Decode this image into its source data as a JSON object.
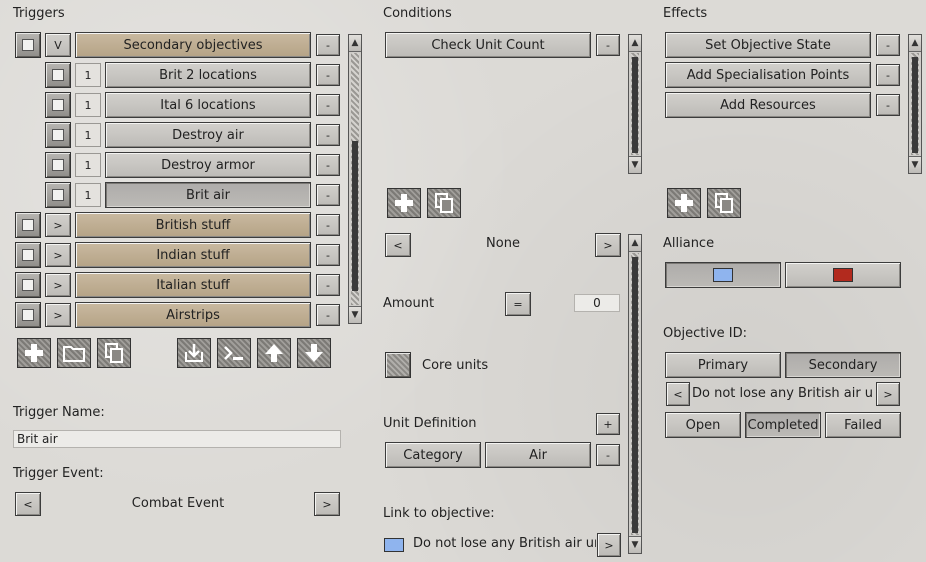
{
  "triggers": {
    "heading": "Triggers",
    "rows": [
      {
        "level": 0,
        "toggle": "V",
        "label": "Secondary objectives",
        "style": "tan"
      },
      {
        "level": 1,
        "count": "1",
        "label": "Brit 2 locations",
        "style": "grey"
      },
      {
        "level": 1,
        "count": "1",
        "label": "Ital 6 locations",
        "style": "grey"
      },
      {
        "level": 1,
        "count": "1",
        "label": "Destroy air",
        "style": "grey"
      },
      {
        "level": 1,
        "count": "1",
        "label": "Destroy armor",
        "style": "grey"
      },
      {
        "level": 1,
        "count": "1",
        "label": "Brit air",
        "style": "selected"
      },
      {
        "level": 0,
        "toggle": ">",
        "label": "British stuff",
        "style": "tan"
      },
      {
        "level": 0,
        "toggle": ">",
        "label": "Indian stuff",
        "style": "tan"
      },
      {
        "level": 0,
        "toggle": ">",
        "label": "Italian stuff",
        "style": "tan"
      },
      {
        "level": 0,
        "toggle": ">",
        "label": "Airstrips",
        "style": "tan"
      }
    ],
    "remove_label": "-",
    "toolbar_icons": [
      "add-icon",
      "folder-icon",
      "copy-icon",
      "import-icon",
      "console-icon",
      "move-up-icon",
      "move-down-icon"
    ],
    "name_label": "Trigger Name:",
    "name_value": "Brit air",
    "event_label": "Trigger Event:",
    "event_value": "Combat Event",
    "prev": "<",
    "next": ">"
  },
  "conditions": {
    "heading": "Conditions",
    "items": [
      "Check Unit Count"
    ],
    "remove_label": "-",
    "selector_value": "None",
    "prev": "<",
    "next": ">",
    "amount_label": "Amount",
    "amount_op": "=",
    "amount_value": "0",
    "core_units_label": "Core units",
    "unit_def_label": "Unit Definition",
    "unit_def_add": "+",
    "unit_def_remove": "-",
    "unit_def_key": "Category",
    "unit_def_value": "Air",
    "link_label": "Link to objective:",
    "link_value": "Do not lose any British air units",
    "link_color": "#8fb4ee"
  },
  "effects": {
    "heading": "Effects",
    "items": [
      "Set Objective State",
      "Add Specialisation Points",
      "Add Resources"
    ],
    "remove_label": "-",
    "alliance_label": "Alliance",
    "alliance_colors": [
      "#8fb4ee",
      "#b22a1e"
    ],
    "objective_label": "Objective ID:",
    "objective_types": [
      "Primary",
      "Secondary"
    ],
    "objective_selected_type": "Secondary",
    "objective_value": "Do not lose any British air units",
    "prev": "<",
    "next": ">",
    "states": [
      "Open",
      "Completed",
      "Failed"
    ],
    "selected_state": "Completed"
  }
}
